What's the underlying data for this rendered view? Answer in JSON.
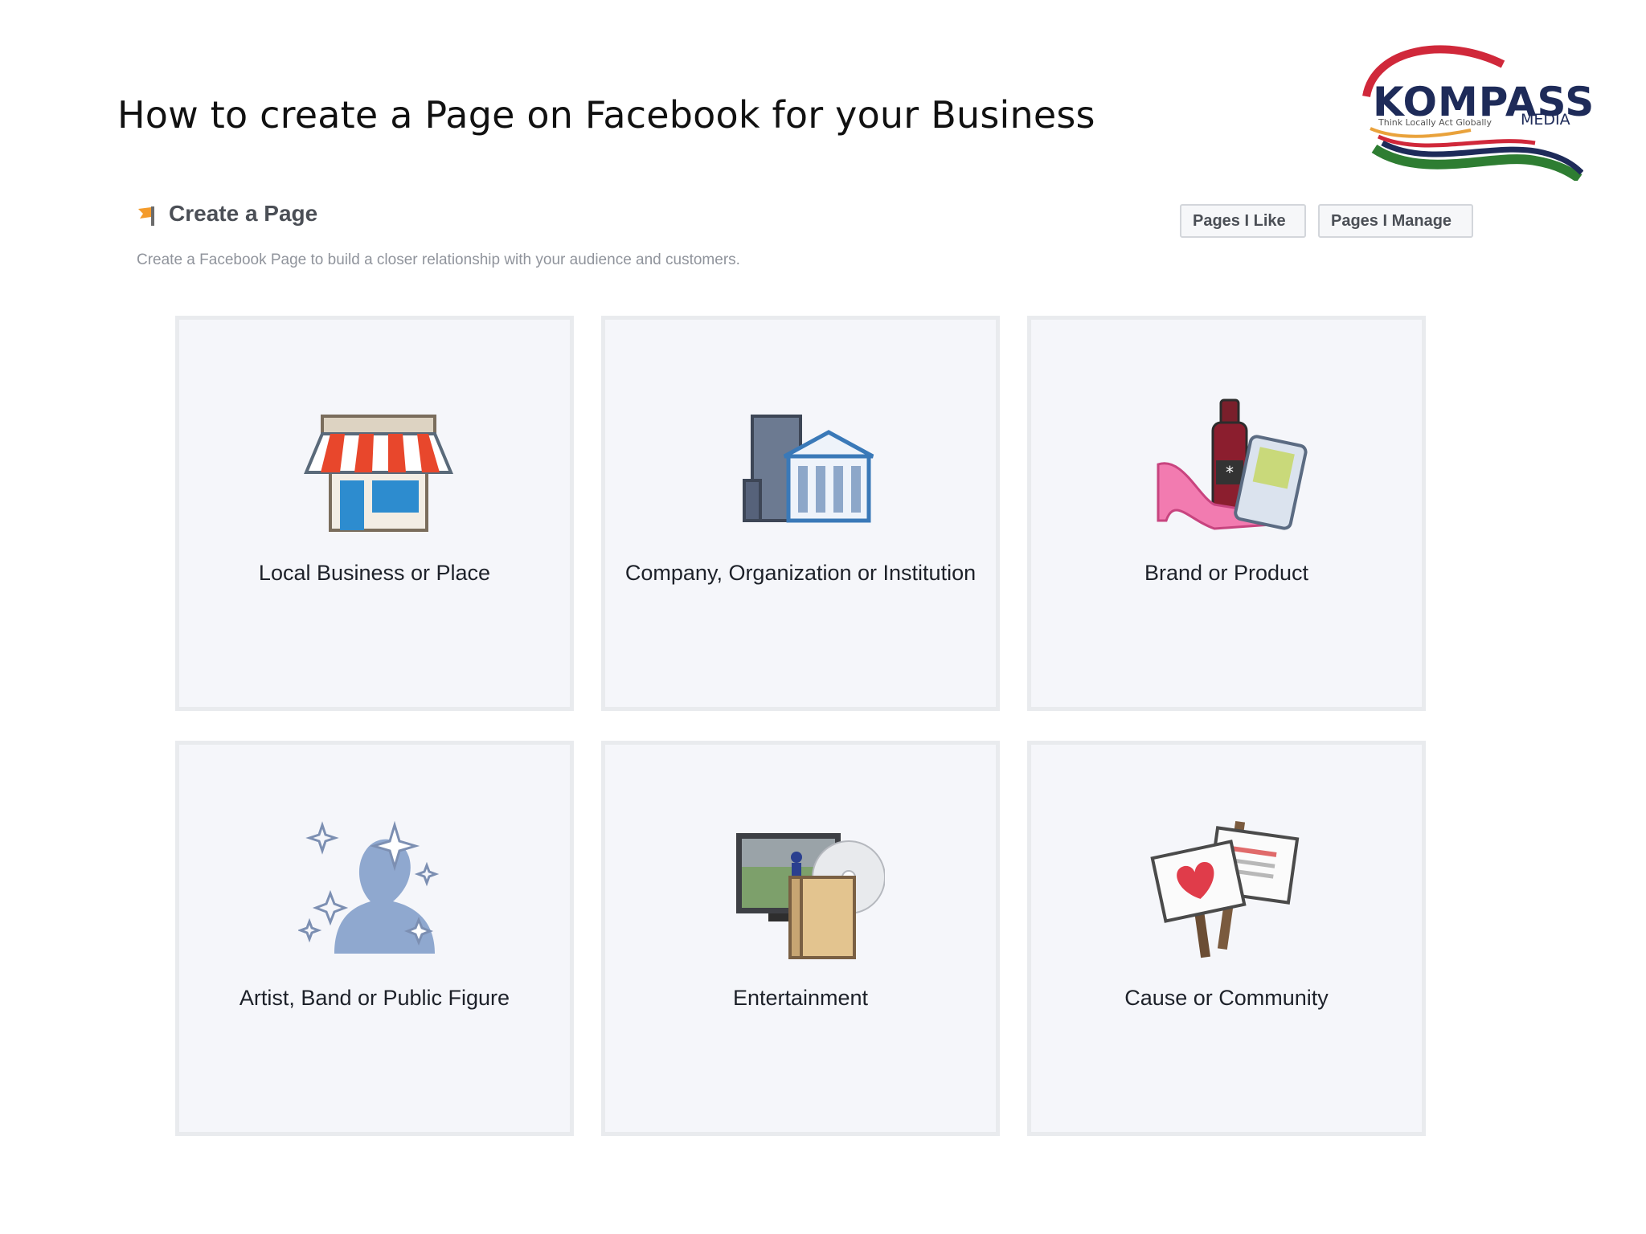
{
  "slide": {
    "title": "How to create a Page on Facebook for your Business"
  },
  "logo": {
    "word": "KOMPASS",
    "tagline": "Think Locally Act Globally",
    "sub": "MEDIA"
  },
  "header": {
    "title": "Create a Page",
    "subtitle": "Create a Facebook Page to build a closer relationship with your audience and customers.",
    "buttons": {
      "pages_like": "Pages I Like",
      "pages_manage": "Pages I Manage"
    }
  },
  "categories": [
    {
      "label": "Local Business or Place",
      "icon": "storefront-icon"
    },
    {
      "label": "Company, Organization or Institution",
      "icon": "buildings-icon"
    },
    {
      "label": "Brand or Product",
      "icon": "products-icon"
    },
    {
      "label": "Artist, Band or Public Figure",
      "icon": "person-icon"
    },
    {
      "label": "Entertainment",
      "icon": "media-icon"
    },
    {
      "label": "Cause or Community",
      "icon": "signs-icon"
    }
  ],
  "colors": {
    "tile_bg": "#f5f6fa",
    "tile_border": "#e9ebee",
    "title_text": "#111111",
    "label_text": "#1d2129",
    "brand_navy": "#1e2b59"
  }
}
